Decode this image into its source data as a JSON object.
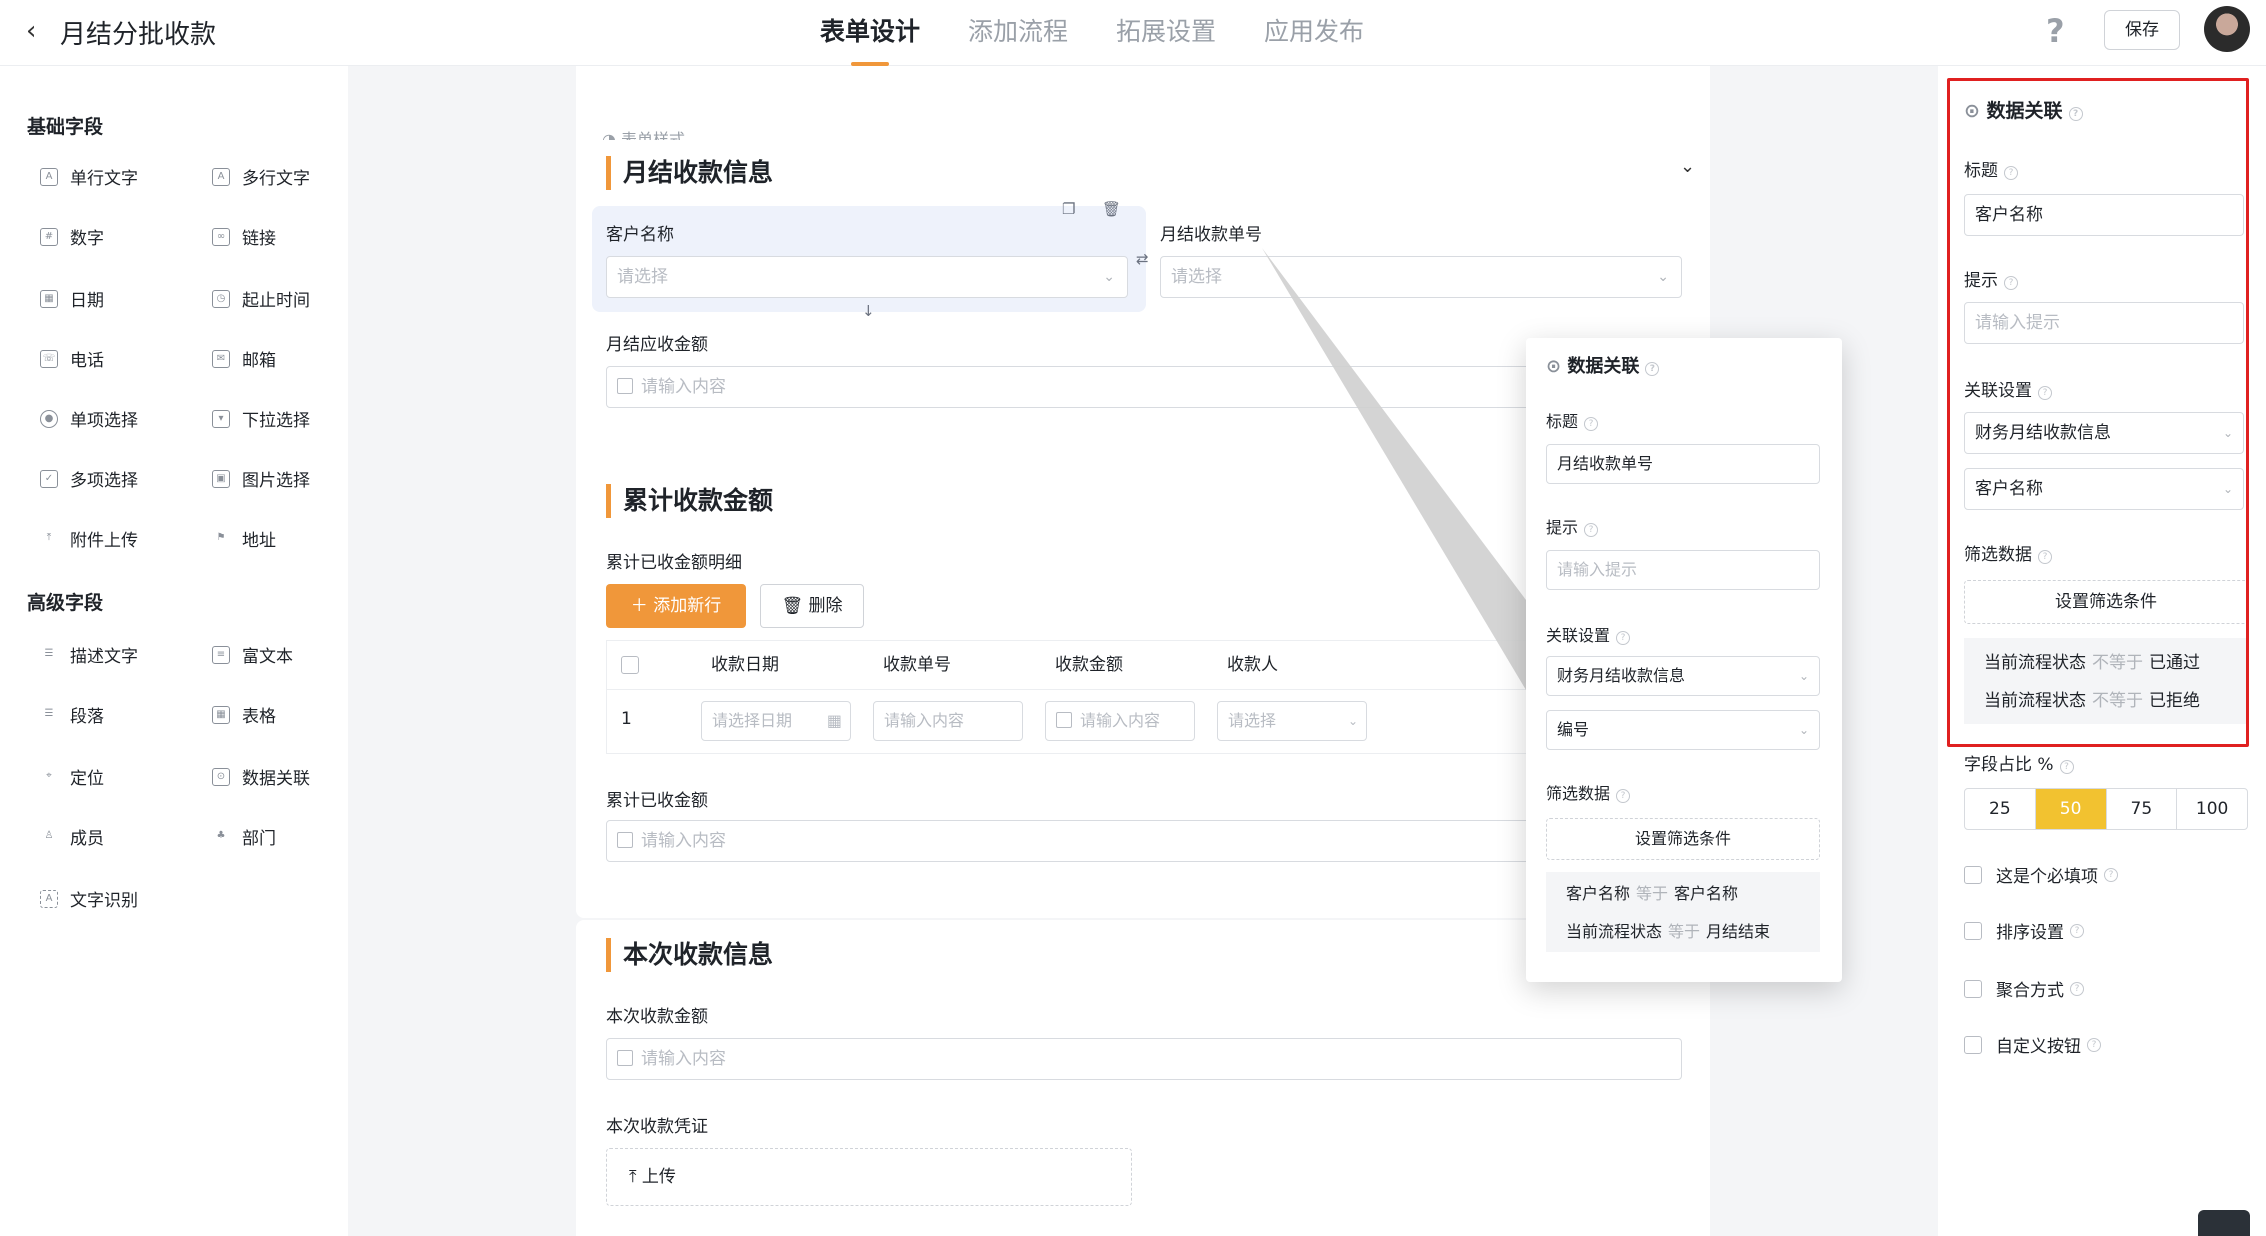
{
  "header": {
    "title": "月结分批收款",
    "tabs": [
      "表单设计",
      "添加流程",
      "拓展设置",
      "应用发布"
    ],
    "help": "?",
    "save_label": "保存"
  },
  "left_panel": {
    "basic_title": "基础字段",
    "basic_fields": [
      "单行文字",
      "多行文字",
      "数字",
      "链接",
      "日期",
      "起止时间",
      "电话",
      "邮箱",
      "单项选择",
      "下拉选择",
      "多项选择",
      "图片选择",
      "附件上传",
      "地址"
    ],
    "advanced_title": "高级字段",
    "advanced_fields": [
      "描述文字",
      "富文本",
      "段落",
      "表格",
      "定位",
      "数据关联",
      "成员",
      "部门",
      "文字识别"
    ]
  },
  "canvas": {
    "form_style": "表单样式",
    "section1": {
      "title": "月结收款信息",
      "customer_label": "客户名称",
      "customer_placeholder": "请选择",
      "number_label": "月结收款单号",
      "number_placeholder": "请选择",
      "amount_label": "月结应收金额",
      "amount_placeholder": "请输入内容"
    },
    "section2": {
      "title": "累计收款金额",
      "detail_label": "累计已收金额明细",
      "add_row": "添加新行",
      "delete": "删除",
      "columns": [
        "收款日期",
        "收款单号",
        "收款金额",
        "收款人"
      ],
      "row_index": "1",
      "row_placeholders": [
        "请选择日期",
        "请输入内容",
        "请输入内容",
        "请选择"
      ],
      "total_label": "累计已收金额",
      "total_placeholder": "请输入内容"
    },
    "section3": {
      "title": "本次收款信息",
      "amount_label": "本次收款金额",
      "amount_placeholder": "请输入内容",
      "voucher_label": "本次收款凭证",
      "upload": "上传"
    }
  },
  "popover": {
    "title": "数据关联",
    "title_label": "标题",
    "title_value": "月结收款单号",
    "hint_label": "提示",
    "hint_placeholder": "请输入提示",
    "assoc_label": "关联设置",
    "assoc_form": "财务月结收款信息",
    "assoc_field": "编号",
    "filter_label": "筛选数据",
    "filter_button": "设置筛选条件",
    "filters": [
      {
        "field": "客户名称",
        "op": "等于",
        "value": "客户名称"
      },
      {
        "field": "当前流程状态",
        "op": "等于",
        "value": "月结结束"
      }
    ]
  },
  "right_panel": {
    "title": "数据关联",
    "title_label": "标题",
    "title_value": "客户名称",
    "hint_label": "提示",
    "hint_placeholder": "请输入提示",
    "assoc_label": "关联设置",
    "assoc_form": "财务月结收款信息",
    "assoc_field": "客户名称",
    "filter_label": "筛选数据",
    "filter_button": "设置筛选条件",
    "filters": [
      {
        "field": "当前流程状态",
        "op": "不等于",
        "value": "已通过"
      },
      {
        "field": "当前流程状态",
        "op": "不等于",
        "value": "已拒绝"
      }
    ],
    "ratio_label": "字段占比 %",
    "ratios": [
      "25",
      "50",
      "75",
      "100"
    ],
    "ratio_selected": "50",
    "options": [
      "这是个必填项",
      "排序设置",
      "聚合方式",
      "自定义按钮"
    ]
  },
  "colors": {
    "accent": "#f0973a",
    "highlight": "#e02020",
    "ratio_on": "#f2c230"
  }
}
